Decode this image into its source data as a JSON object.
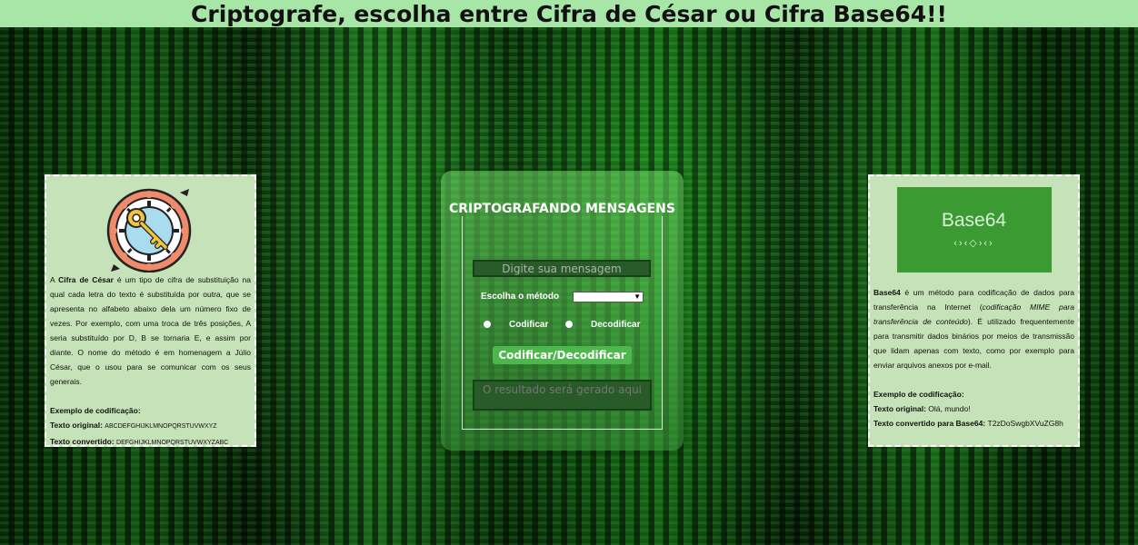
{
  "header": {
    "title": "Criptografe, escolha entre Cifra de César ou Cifra Base64!!"
  },
  "caesar": {
    "intro_prefix": "A ",
    "name": "Cifra de César",
    "intro_text": " é um tipo de cifra de substituição na qual cada letra do texto é substituída por outra, que se apresenta no alfabeto abaixo dela um número fixo de vezes. Por exemplo, com uma troca de três posições, A seria substituído por D, B se tornaria E, e assim por diante. O nome do método é em homenagem a Júlio César, que o usou para se comunicar com os seus generais.",
    "example_heading": "Exemplo de codificação:",
    "original_label": "Texto original: ",
    "original_value": "ABCDEFGHIJKLMNOPQRSTUVWXYZ",
    "converted_label": "Texto convertido: ",
    "converted_value": "DEFGHIJKLMNOPQRSTUVWXYZABC"
  },
  "base64": {
    "logo_text": "Base64",
    "logo_arrows": "‹›‹◇›‹›",
    "name": "Base64",
    "intro_text_1": " é um método para codificação de dados para transferência na Internet (",
    "intro_italic": "codificação MIME para transferência de conteúdo",
    "intro_text_2": "). É utilizado frequentemente para transmitir dados binários por meios de transmissão que lidam apenas com texto, como por exemplo para enviar arquivos anexos por e-mail.",
    "example_heading": "Exemplo de codificação:",
    "original_label": "Texto original: ",
    "original_value": "Olá, mundo!",
    "converted_label": "Texto convertido para Base64: ",
    "converted_value": "T2zDoSwgbXVuZG8h"
  },
  "panel": {
    "title": "CRIPTOGRAFANDO MENSAGENS",
    "message_placeholder": "Digite sua mensagem",
    "method_label": "Escolha o método",
    "method_selected": "",
    "encode_label": "Codificar",
    "decode_label": "Decodificar",
    "action_button": "Codificar/Decodificar",
    "result_placeholder": "O resultado será gerado aqui"
  }
}
